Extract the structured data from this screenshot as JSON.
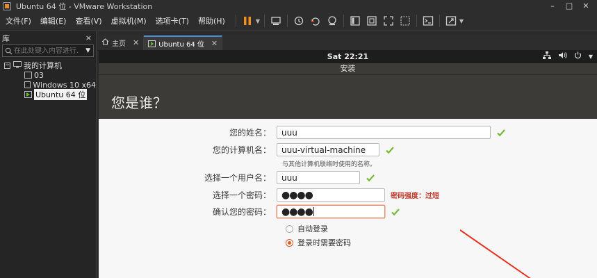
{
  "window": {
    "title": "Ubuntu 64 位 - VMware Workstation",
    "controls": [
      "–",
      "□",
      "✕"
    ]
  },
  "menu": [
    "文件(F)",
    "编辑(E)",
    "查看(V)",
    "虚拟机(M)",
    "选项卡(T)",
    "帮助(H)"
  ],
  "toolbar": {
    "icons": [
      "pause-icon",
      "send-ctrl-alt-del-icon",
      "snapshot-icon",
      "revert-snapshot-icon",
      "snapshot-manager-icon",
      "library-view-icon",
      "thumbnail-view-icon",
      "fullscreen-icon",
      "unity-icon",
      "console-icon",
      "stretch-icon"
    ],
    "accent": "#f28c1b"
  },
  "library": {
    "title": "库",
    "close": "×",
    "search_placeholder": "在此处键入内容进行...",
    "tree": {
      "root": "我的计算机",
      "items": [
        {
          "label": "03",
          "running": false,
          "selected": false
        },
        {
          "label": "Windows 10 x64",
          "running": false,
          "selected": false
        },
        {
          "label": "Ubuntu 64 位",
          "running": true,
          "selected": true
        }
      ]
    }
  },
  "tabs": [
    {
      "label": "主页",
      "active": false
    },
    {
      "label": "Ubuntu 64 位",
      "active": true
    }
  ],
  "guest": {
    "clock": "Sat 22:21",
    "install_title": "安装",
    "heading": "您是谁？",
    "fields": {
      "name": {
        "label": "您的姓名：",
        "value": "uuu"
      },
      "computer": {
        "label": "您的计算机名：",
        "value": "uuu-virtual-machine"
      },
      "computer_hint": "与其他计算机联络时使用的名称。",
      "username": {
        "label": "选择一个用户名：",
        "value": "uuu"
      },
      "password": {
        "label": "选择一个密码：",
        "value": "●●●●",
        "strength": "密码强度：过短"
      },
      "confirm": {
        "label": "确认您的密码：",
        "value": "●●●●"
      }
    },
    "login_options": {
      "auto": "自动登录",
      "require": "登录时需要密码",
      "selected": "require"
    }
  }
}
